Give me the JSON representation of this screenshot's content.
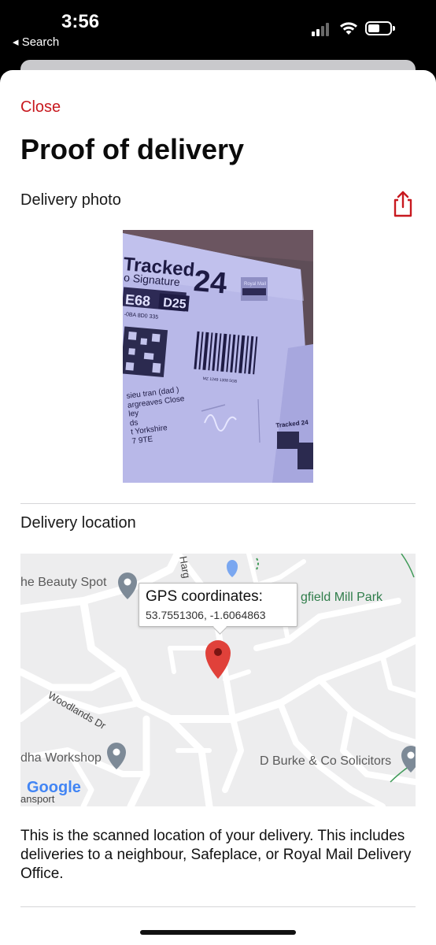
{
  "status_bar": {
    "time": "3:56",
    "back_label": "◂ Search"
  },
  "sheet": {
    "close_label": "Close",
    "title": "Proof of delivery",
    "photo_section": {
      "label": "Delivery photo",
      "share_icon": "share-icon",
      "photo_text": {
        "service": "Tracked 24",
        "service_line1": "Tracked",
        "service_line2": "o Signature",
        "service_number": "24",
        "code_prefix": "E68",
        "code_box": "D25",
        "ref": "-0BA 8D0 335",
        "barcode_caption": "MZ 1249 1308 5GB",
        "address_lines": [
          "sieu tran (dad )",
          "argreaves Close",
          "ley",
          "ds",
          "t Yorkshire",
          "7 9TE"
        ],
        "brand": "Royal Mail"
      }
    },
    "location_section": {
      "label": "Delivery location",
      "map": {
        "places": [
          {
            "name": "he Beauty Spot"
          },
          {
            "name": "gfield Mill Park"
          },
          {
            "name": "dha Workshop"
          },
          {
            "name": "D Burke & Co Solicitors"
          }
        ],
        "streets": [
          "Woodlands Dr",
          "Harg"
        ],
        "callout_title": "GPS coordinates:",
        "callout_coords": "53.7551306, -1.6064863",
        "logo": "Google",
        "logo_sub": "ansport"
      },
      "description": "This is the scanned location of your delivery.  This includes deliveries to a neighbour, Safeplace, or Royal Mail Delivery Office."
    }
  },
  "colors": {
    "accent": "#c8191f",
    "map_background": "#ededee",
    "pin": "#e0413a"
  }
}
